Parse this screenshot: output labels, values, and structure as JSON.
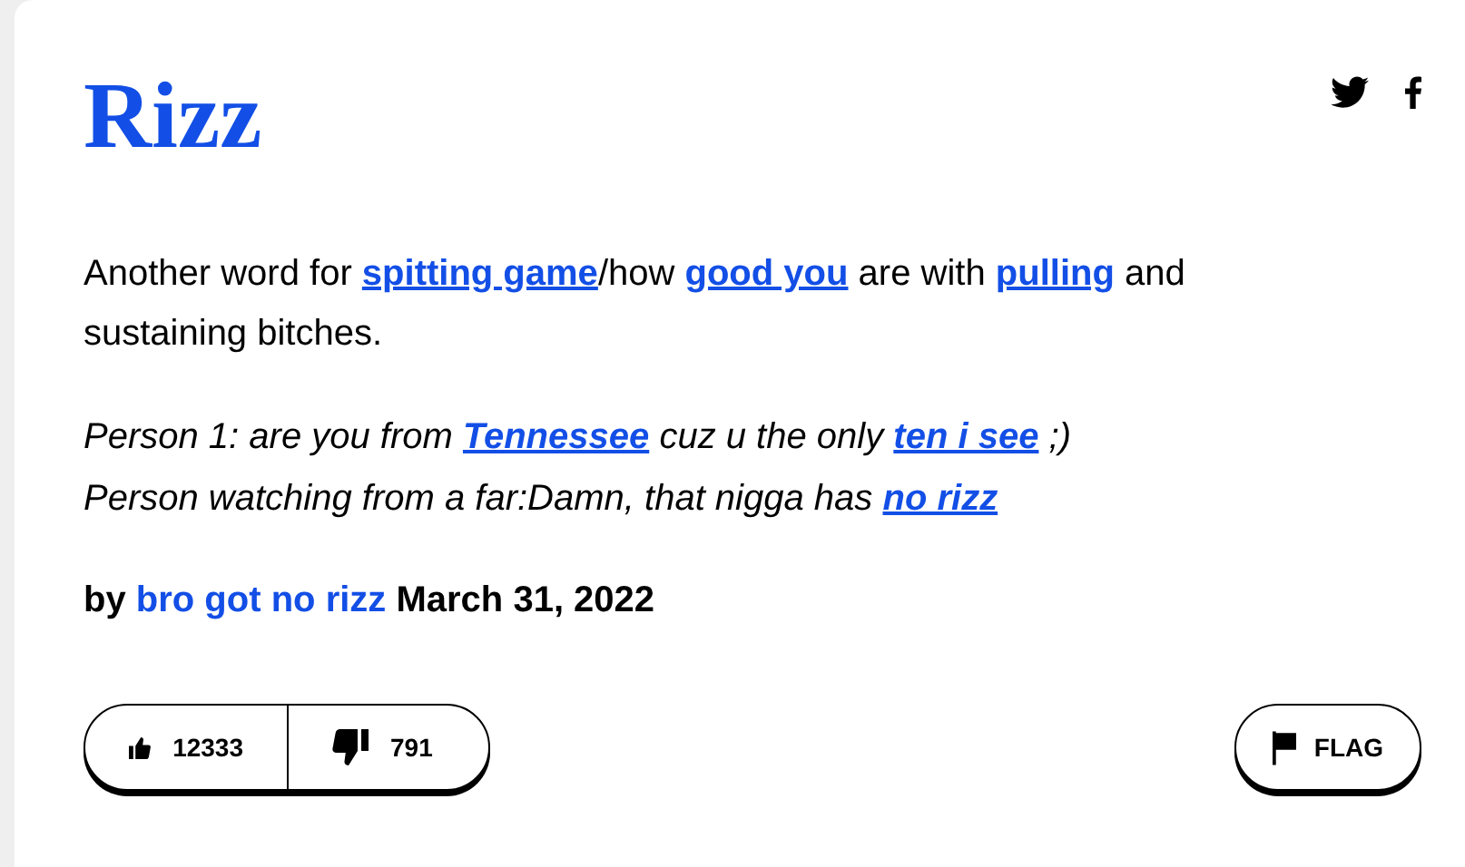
{
  "word": "Rizz",
  "share": [
    {
      "kind": "twitter"
    },
    {
      "kind": "facebook"
    }
  ],
  "meaning": [
    {
      "text": "Another word for ",
      "link": false
    },
    {
      "text": "spitting game",
      "link": true
    },
    {
      "text": "/how ",
      "link": false
    },
    {
      "text": "good you",
      "link": true
    },
    {
      "text": " are with ",
      "link": false
    },
    {
      "text": "pulling",
      "link": true
    },
    {
      "text": " and sustaining bitches.",
      "link": false
    }
  ],
  "example": [
    [
      {
        "text": "Person 1: are you from ",
        "link": false
      },
      {
        "text": "Tennessee",
        "link": true
      },
      {
        "text": " cuz u the only ",
        "link": false
      },
      {
        "text": "ten i see",
        "link": true
      },
      {
        "text": " ;)",
        "link": false
      }
    ],
    [
      {
        "text": "Person watching from a far:Damn, that nigga has ",
        "link": false
      },
      {
        "text": "no rizz",
        "link": true
      }
    ]
  ],
  "byline": {
    "prefix": "by",
    "author": "bro got no rizz",
    "date": "March 31, 2022"
  },
  "votes": {
    "up": "12333",
    "down": "791"
  },
  "flag": "FLAG"
}
